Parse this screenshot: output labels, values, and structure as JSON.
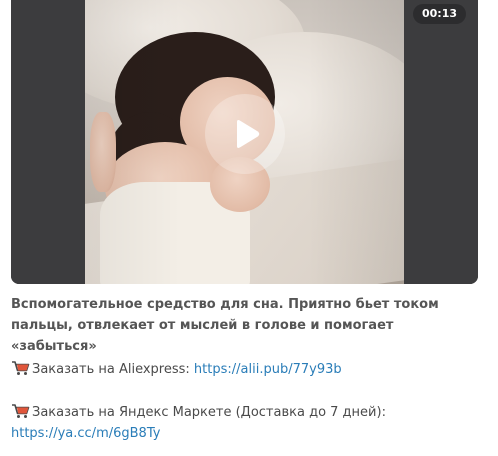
{
  "video": {
    "duration": "00:13",
    "play_icon": "play-icon"
  },
  "description": "Вспомогательное средство для сна. Приятно бьет током пальцы, отвлекает от мыслей в голове и помогает «забыться»",
  "orders": [
    {
      "icon": "shopping-cart-icon",
      "label": "Заказать на Aliexpress: ",
      "link": "https://alii.pub/77y93b"
    },
    {
      "icon": "shopping-cart-icon",
      "label": "Заказать на Яндекс Маркете (Доставка до 7 дней):",
      "link": "https://ya.cc/m/6gB8Ty"
    }
  ],
  "colors": {
    "link": "#2a7db8",
    "text": "#4a4a4a",
    "description": "#555555",
    "badge_bg": "#28282a"
  }
}
